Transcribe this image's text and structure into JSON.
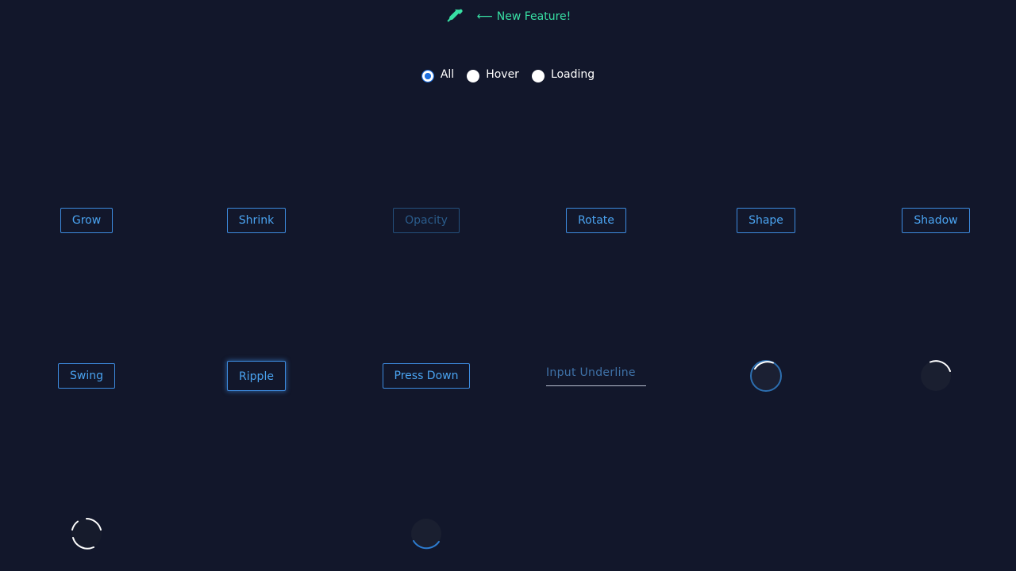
{
  "header": {
    "picker_icon": "color-picker-icon",
    "feature_link_label": "New Feature!",
    "arrow_icon": "arrow-left-icon",
    "accent_color": "#38e0a4"
  },
  "filters": {
    "options": [
      {
        "label": "All",
        "checked": true
      },
      {
        "label": "Hover",
        "checked": false
      },
      {
        "label": "Loading",
        "checked": false
      }
    ],
    "checked_color": "#1d6fe0"
  },
  "buttons": {
    "grow": "Grow",
    "shrink": "Shrink",
    "opacity": "Opacity",
    "rotate": "Rotate",
    "shape": "Shape",
    "shadow": "Shadow",
    "swing": "Swing",
    "ripple": "Ripple",
    "press_down": "Press Down",
    "button_color": "#4aa3f0"
  },
  "input": {
    "placeholder": "Input Underline",
    "value": ""
  },
  "spinners": [
    "loading-spinner-1",
    "loading-spinner-2",
    "loading-spinner-3",
    "loading-spinner-4"
  ],
  "background_color": "#12172b"
}
